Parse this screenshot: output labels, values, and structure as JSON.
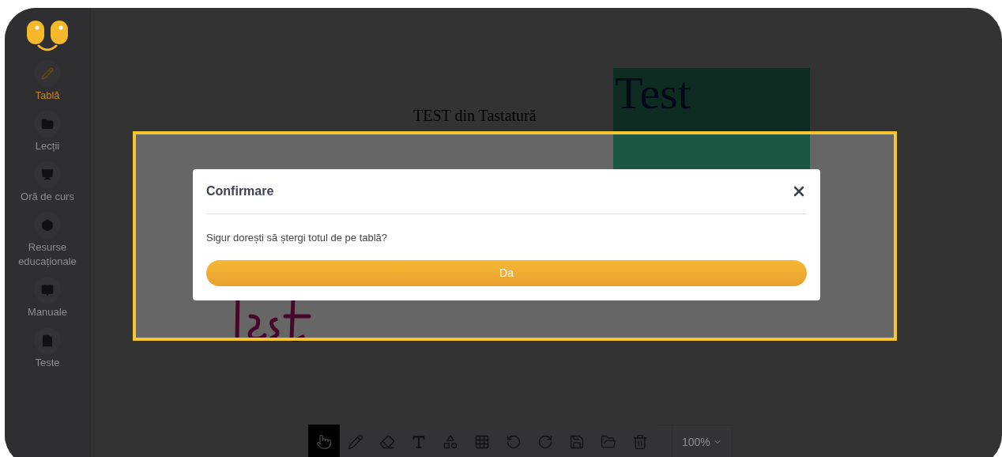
{
  "sidebar": {
    "items": [
      {
        "kind": "pencil",
        "label": "Tablă",
        "selected": true
      },
      {
        "kind": "folder",
        "label": "Lecții",
        "selected": false
      },
      {
        "kind": "teacher",
        "label": "Oră de curs",
        "selected": false
      },
      {
        "kind": "box",
        "label": "Resurse educaționale",
        "selected": false
      },
      {
        "kind": "book",
        "label": "Manuale",
        "selected": false
      },
      {
        "kind": "file",
        "label": "Teste",
        "selected": false
      }
    ]
  },
  "board": {
    "heading": "TEST din Tastatură",
    "box_text": "Test"
  },
  "toolbar": {
    "tools": [
      {
        "kind": "hand",
        "selected": true
      },
      {
        "kind": "pencil",
        "selected": false
      },
      {
        "kind": "eraser",
        "selected": false
      },
      {
        "kind": "text",
        "selected": false
      },
      {
        "kind": "shapes",
        "selected": false
      },
      {
        "kind": "grid",
        "selected": false
      },
      {
        "kind": "undo",
        "selected": false
      },
      {
        "kind": "redo",
        "selected": false
      },
      {
        "kind": "save",
        "selected": false
      },
      {
        "kind": "open",
        "selected": false
      },
      {
        "kind": "trash",
        "selected": false
      }
    ],
    "zoom": "100%"
  },
  "dialog": {
    "title": "Confirmare",
    "message": "Sigur dorești să ștergi totul de pe tablă?",
    "confirm": "Da"
  }
}
